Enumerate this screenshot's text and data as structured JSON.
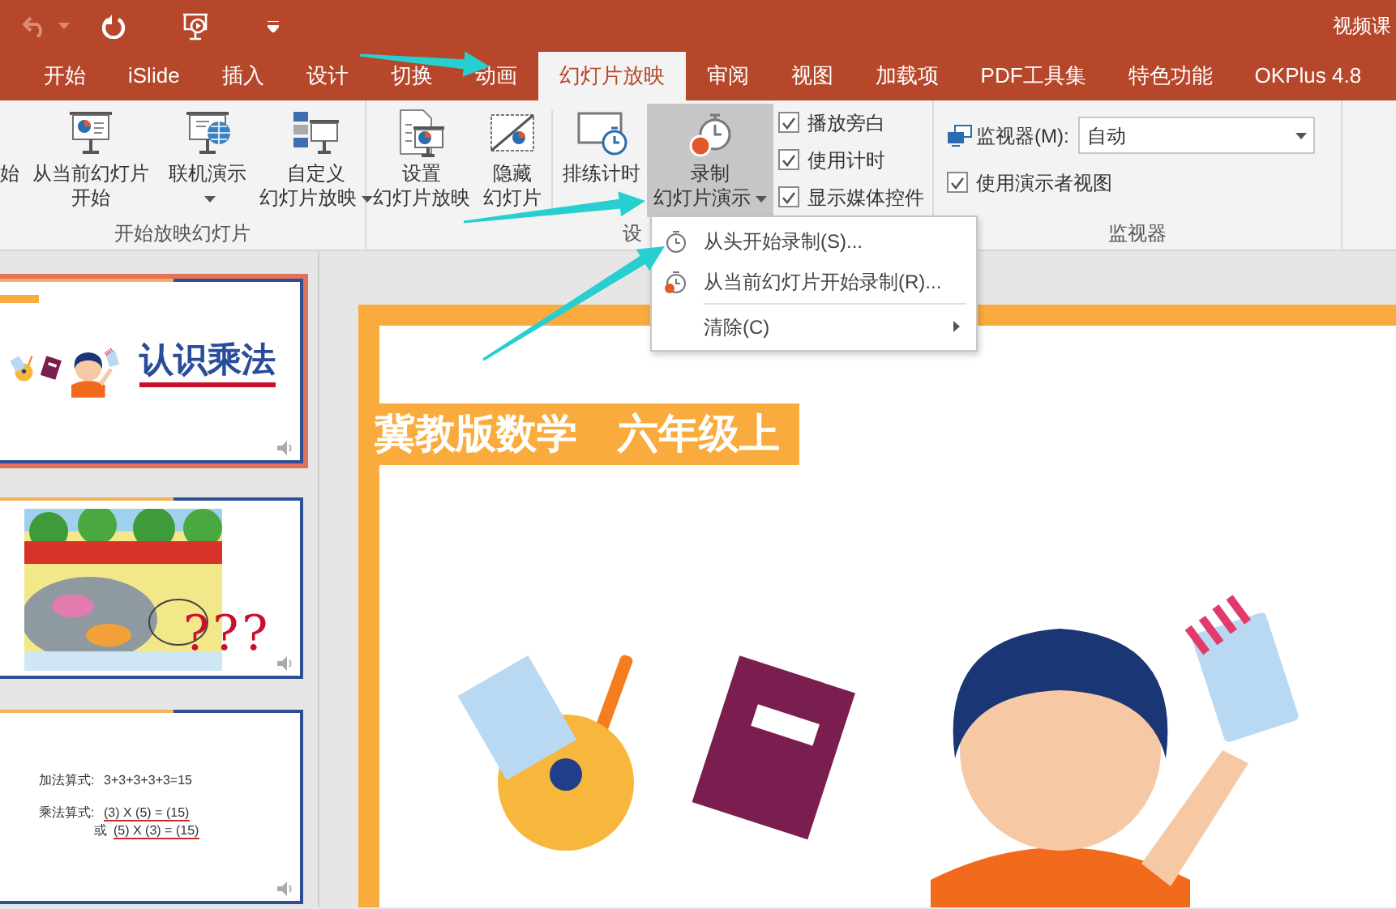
{
  "window": {
    "title": "视频课"
  },
  "quick_access": {
    "undo_disabled": true
  },
  "tabs": [
    {
      "label": "开始",
      "selected": false
    },
    {
      "label": "iSlide",
      "selected": false
    },
    {
      "label": "插入",
      "selected": false
    },
    {
      "label": "设计",
      "selected": false
    },
    {
      "label": "切换",
      "selected": false
    },
    {
      "label": "动画",
      "selected": false
    },
    {
      "label": "幻灯片放映",
      "selected": true
    },
    {
      "label": "审阅",
      "selected": false
    },
    {
      "label": "视图",
      "selected": false
    },
    {
      "label": "加载项",
      "selected": false
    },
    {
      "label": "PDF工具集",
      "selected": false
    },
    {
      "label": "特色功能",
      "selected": false
    },
    {
      "label": "OKPlus 4.8",
      "selected": false
    }
  ],
  "ribbon": {
    "groups": [
      {
        "label": "开始放映幻灯片",
        "buttons": [
          {
            "lines": [
              "始"
            ],
            "dropdown": false,
            "pressed": false
          },
          {
            "lines": [
              "从当前幻灯片",
              "开始"
            ],
            "dropdown": false,
            "pressed": false
          },
          {
            "lines": [
              "联机演示"
            ],
            "dropdown": true,
            "pressed": false
          },
          {
            "lines": [
              "自定义",
              "幻灯片放映"
            ],
            "dropdown": true,
            "pressed": false
          }
        ]
      },
      {
        "label": "设",
        "buttons": [
          {
            "lines": [
              "设置",
              "幻灯片放映"
            ],
            "dropdown": false,
            "pressed": false
          },
          {
            "lines": [
              "隐藏",
              "幻灯片"
            ],
            "dropdown": false,
            "pressed": false
          },
          {
            "lines": [
              "排练计时"
            ],
            "dropdown": false,
            "pressed": false
          },
          {
            "lines": [
              "录制",
              "幻灯片演示"
            ],
            "dropdown": true,
            "pressed": true
          }
        ],
        "checkboxes": [
          {
            "label": "播放旁白",
            "checked": true
          },
          {
            "label": "使用计时",
            "checked": true
          },
          {
            "label": "显示媒体控件",
            "checked": true
          }
        ]
      },
      {
        "label": "监视器",
        "monitor": {
          "label": "监视器(M):",
          "value": "自动"
        },
        "checkboxes": [
          {
            "label": "使用演示者视图",
            "checked": true
          }
        ]
      }
    ]
  },
  "menu": {
    "items": [
      {
        "kind": "item",
        "label": "从头开始录制(S)..."
      },
      {
        "kind": "item",
        "label": "从当前幻灯片开始录制(R)..."
      },
      {
        "kind": "separator"
      },
      {
        "kind": "submenu",
        "label": "清除(C)"
      }
    ]
  },
  "thumbnails": [
    {
      "kind": "title",
      "selected": true,
      "title": "认识乘法"
    },
    {
      "kind": "picture",
      "selected": false,
      "marks": "???"
    },
    {
      "kind": "formula",
      "selected": false,
      "rows": [
        {
          "label": "加法算式:",
          "value": "3+3+3+3+3=15"
        },
        {
          "label": "乘法算式:",
          "value": "(3) X (5) = (15)"
        },
        {
          "label": "或",
          "value": "(5) X (3) = (15)"
        }
      ]
    }
  ],
  "slide": {
    "banner": "冀教版数学　六年级上"
  }
}
